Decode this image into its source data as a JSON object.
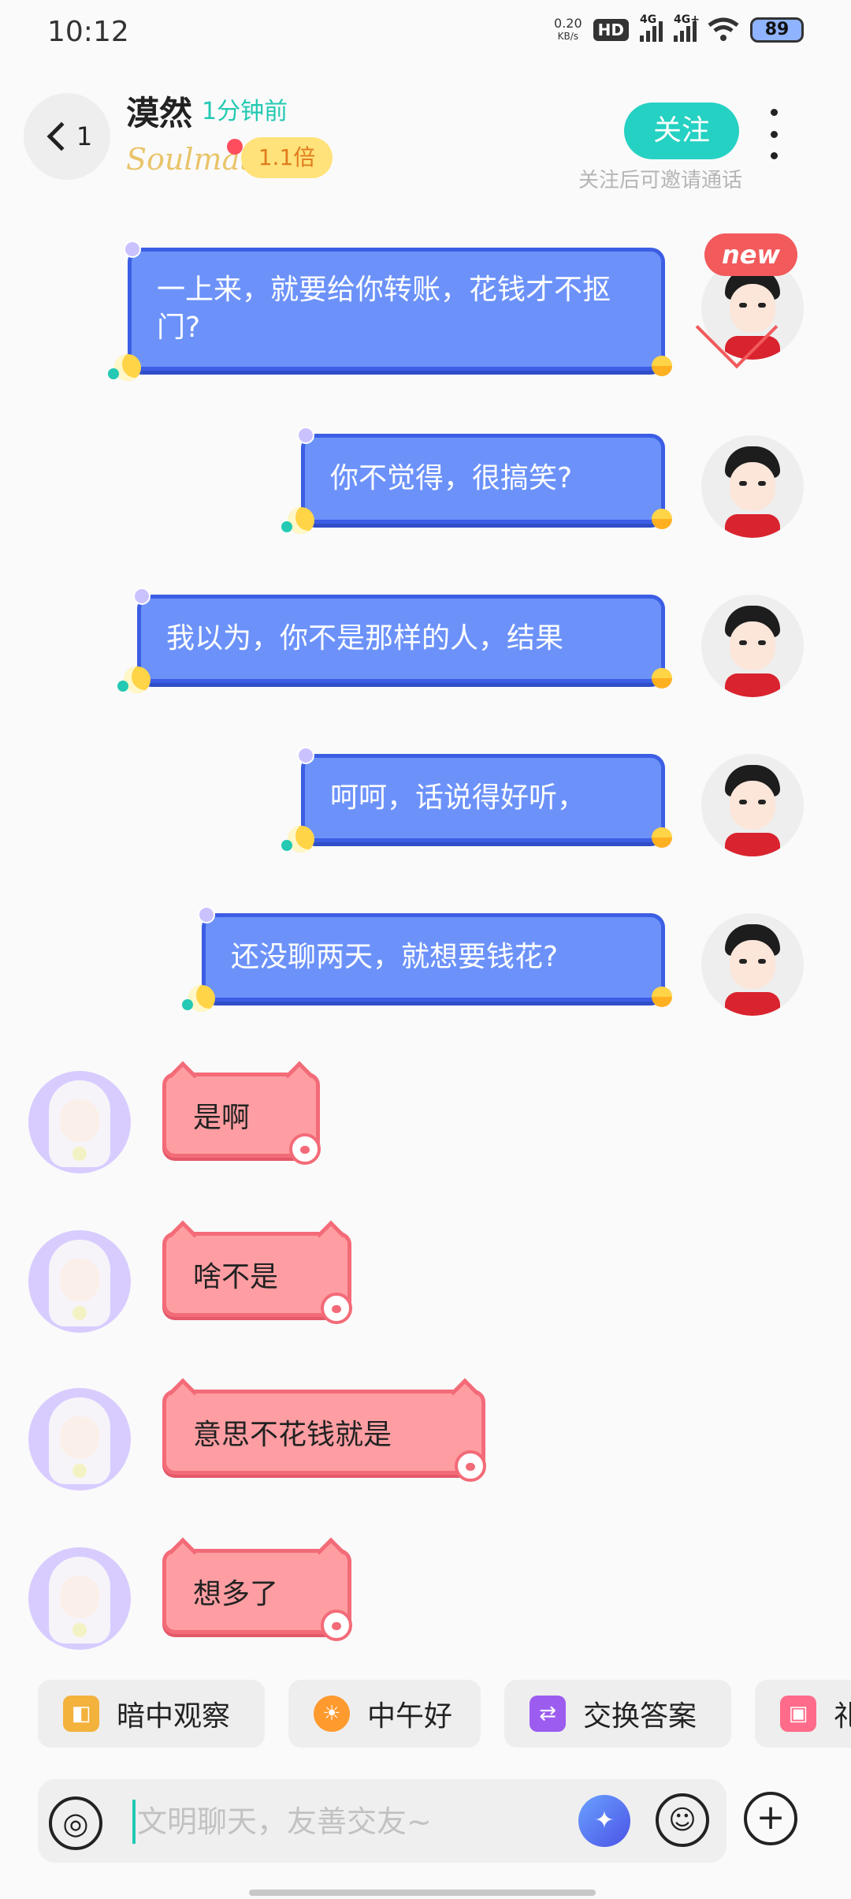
{
  "status_bar": {
    "time": "10:12",
    "net_speed_value": "0.20",
    "net_speed_unit": "KB/s",
    "hd_label": "HD",
    "sig1": "4G",
    "sig2": "4G+",
    "battery": "89"
  },
  "header": {
    "back_count": "1",
    "name": "漠然",
    "last_active": "1分钟前",
    "brand": "Soulmate",
    "multiplier": "1.1倍",
    "follow_label": "关注",
    "follow_hint": "关注后可邀请通话"
  },
  "badge_new": "new",
  "messages_out": [
    {
      "text": "一上来，就要给你转账，花钱才不抠门?"
    },
    {
      "text": "你不觉得，很搞笑?"
    },
    {
      "text": "我以为，你不是那样的人，结果"
    },
    {
      "text": "呵呵，话说得好听，"
    },
    {
      "text": "还没聊两天，就想要钱花?"
    }
  ],
  "messages_in": [
    {
      "text": "是啊"
    },
    {
      "text": "啥不是"
    },
    {
      "text": "意思不花钱就是"
    },
    {
      "text": "想多了"
    }
  ],
  "quick_chips": [
    {
      "label": "暗中观察",
      "icon": "bear-peek-icon",
      "color": "#f2b23c"
    },
    {
      "label": "中午好",
      "icon": "sun-sunglasses-icon",
      "color": "#ff9a2e"
    },
    {
      "label": "交换答案",
      "icon": "exchange-icon",
      "color": "#9c5cf0"
    },
    {
      "label": "礼",
      "icon": "gift-icon",
      "color": "#ff6b8a"
    }
  ],
  "input": {
    "placeholder": "文明聊天，友善交友~"
  },
  "colors": {
    "accent": "#25d1c2",
    "out_bubble": "#6c92fa",
    "in_bubble": "#ff9ea2"
  }
}
